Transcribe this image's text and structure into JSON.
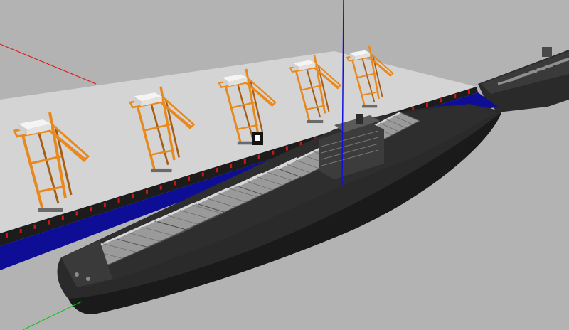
{
  "scene": {
    "colors": {
      "background": "#b3b3b3",
      "quay_top": "#d4d4d4",
      "quay_side": "#1c1c1c",
      "water": "#0d0d96",
      "crane": "#e8891e",
      "crane_dark": "#a85e12",
      "crane_housing": "#f4f4f4",
      "hull": "#2a2a2a",
      "hull_shade": "#1a1a1a",
      "deck_cover": "#9a9a9a",
      "fender": "#c51818",
      "axis_x": "#e01010",
      "axis_y": "#10c010",
      "axis_z": "#1010e0"
    },
    "objects": {
      "cranes": 5,
      "ships": 2,
      "hatch_covers_main_ship": 8
    }
  }
}
